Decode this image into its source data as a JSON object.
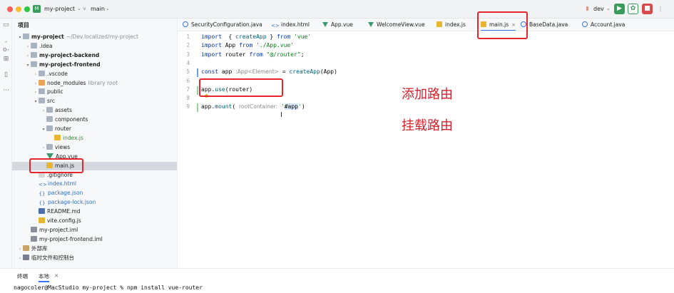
{
  "titlebar": {
    "project_badge": "M",
    "project_name": "my-project",
    "branch_icon": "branch-icon",
    "branch": "main",
    "run_config": "dev",
    "run_icon": "run-icon",
    "debug_icon": "debug-icon"
  },
  "colors": {
    "accent": "#3574f0",
    "annotation": "#e5262d",
    "run": "#3a9b5c",
    "debug": "#d84a4a"
  },
  "project_panel": {
    "header": "项目",
    "rows": [
      {
        "indent": 0,
        "arrow": "▾",
        "icon": "folder",
        "label": "my-project",
        "bold": true,
        "suffix": "~/Dev.localized/my-project"
      },
      {
        "indent": 1,
        "arrow": "›",
        "icon": "folder",
        "label": ".idea"
      },
      {
        "indent": 1,
        "arrow": "›",
        "icon": "folder",
        "label": "my-project-backend",
        "bold": true
      },
      {
        "indent": 1,
        "arrow": "▾",
        "icon": "folder",
        "label": "my-project-frontend",
        "bold": true
      },
      {
        "indent": 2,
        "arrow": "›",
        "icon": "folder",
        "label": ".vscode"
      },
      {
        "indent": 2,
        "arrow": "›",
        "icon": "folder-orange",
        "label": "node_modules",
        "suffix": "library root"
      },
      {
        "indent": 2,
        "arrow": "›",
        "icon": "folder",
        "label": "public"
      },
      {
        "indent": 2,
        "arrow": "▾",
        "icon": "folder",
        "label": "src"
      },
      {
        "indent": 3,
        "arrow": "›",
        "icon": "folder",
        "label": "assets"
      },
      {
        "indent": 3,
        "arrow": "",
        "icon": "folder",
        "label": "components"
      },
      {
        "indent": 3,
        "arrow": "▾",
        "icon": "folder",
        "label": "router"
      },
      {
        "indent": 4,
        "arrow": "",
        "icon": "js",
        "label": "index.js",
        "color": "green"
      },
      {
        "indent": 3,
        "arrow": "›",
        "icon": "folder",
        "label": "views"
      },
      {
        "indent": 3,
        "arrow": "",
        "icon": "vue",
        "label": "App.vue"
      },
      {
        "indent": 3,
        "arrow": "",
        "icon": "js",
        "label": "main.js",
        "selected": true
      },
      {
        "indent": 2,
        "arrow": "",
        "icon": "git",
        "label": ".gitignore"
      },
      {
        "indent": 2,
        "arrow": "",
        "icon": "html",
        "label": "index.html",
        "color": "blue"
      },
      {
        "indent": 2,
        "arrow": "",
        "icon": "json",
        "label": "package.json",
        "color": "blue"
      },
      {
        "indent": 2,
        "arrow": "",
        "icon": "json",
        "label": "package-lock.json",
        "color": "blue"
      },
      {
        "indent": 2,
        "arrow": "",
        "icon": "md",
        "label": "README.md"
      },
      {
        "indent": 2,
        "arrow": "",
        "icon": "js",
        "label": "vite.config.js"
      },
      {
        "indent": 1,
        "arrow": "",
        "icon": "iml",
        "label": "my-project.iml"
      },
      {
        "indent": 1,
        "arrow": "",
        "icon": "iml",
        "label": "my-project-frontend.iml"
      },
      {
        "indent": 0,
        "arrow": "›",
        "icon": "lib",
        "label": "外部库"
      },
      {
        "indent": 0,
        "arrow": "›",
        "icon": "console",
        "label": "临时文件和控制台"
      }
    ]
  },
  "tabs": [
    {
      "icon": "java",
      "label": "SecurityConfiguration.java"
    },
    {
      "icon": "html",
      "label": "index.html"
    },
    {
      "icon": "vue",
      "label": "App.vue"
    },
    {
      "icon": "vue",
      "label": "WelcomeView.vue"
    },
    {
      "icon": "js",
      "label": "index.js"
    },
    {
      "icon": "js",
      "label": "main.js",
      "active": true,
      "close": "×"
    },
    {
      "icon": "java",
      "label": "BaseData.java"
    },
    {
      "icon": "java",
      "label": "Account.java"
    }
  ],
  "editor": {
    "line_numbers": [
      "1",
      "2",
      "3",
      "4",
      "5",
      "6",
      "7",
      "8",
      "9"
    ],
    "lines": [
      {
        "n": 1,
        "parts": [
          [
            "kw",
            "import"
          ],
          [
            "",
            "  { "
          ],
          [
            "fn",
            "createApp"
          ],
          [
            "",
            " } "
          ],
          [
            "kw",
            "from"
          ],
          [
            "str",
            " 'vue'"
          ]
        ]
      },
      {
        "n": 2,
        "parts": [
          [
            "kw",
            "import"
          ],
          [
            "",
            " App "
          ],
          [
            "kw",
            "from"
          ],
          [
            "str",
            " './App.vue'"
          ]
        ]
      },
      {
        "n": 3,
        "parts": [
          [
            "kw",
            "import"
          ],
          [
            "",
            " router "
          ],
          [
            "kw",
            "from"
          ],
          [
            "str",
            " \"@/router\""
          ],
          [
            "",
            ";"
          ]
        ]
      },
      {
        "n": 4,
        "parts": []
      },
      {
        "n": 5,
        "parts": [
          [
            "kw",
            "const"
          ],
          [
            "",
            " app "
          ],
          [
            "hint",
            ":App<Element>"
          ],
          [
            "",
            " = "
          ],
          [
            "fn",
            "createApp"
          ],
          [
            "",
            "(App)"
          ]
        ]
      },
      {
        "n": 6,
        "parts": []
      },
      {
        "n": 7,
        "parts": [
          [
            "",
            "app."
          ],
          [
            "fn",
            "use"
          ],
          [
            "",
            "(router)"
          ]
        ]
      },
      {
        "n": 8,
        "parts": []
      },
      {
        "n": 9,
        "parts": [
          [
            "",
            "app."
          ],
          [
            "fn",
            "mount"
          ],
          [
            "",
            "( "
          ],
          [
            "hint",
            "rootContainer:"
          ],
          [
            "str",
            " '"
          ],
          [
            "hl",
            "#app"
          ],
          [
            "str",
            "'"
          ],
          [
            "",
            ")"
          ]
        ]
      }
    ],
    "annotation_use": "添加路由",
    "annotation_mount": "挂载路由"
  },
  "bottom": {
    "tab_terminal": "终端",
    "tab_local": "本地",
    "tab_close": "×",
    "command_line": "nagocoler@MacStudio my-project % npm install vue-router"
  }
}
